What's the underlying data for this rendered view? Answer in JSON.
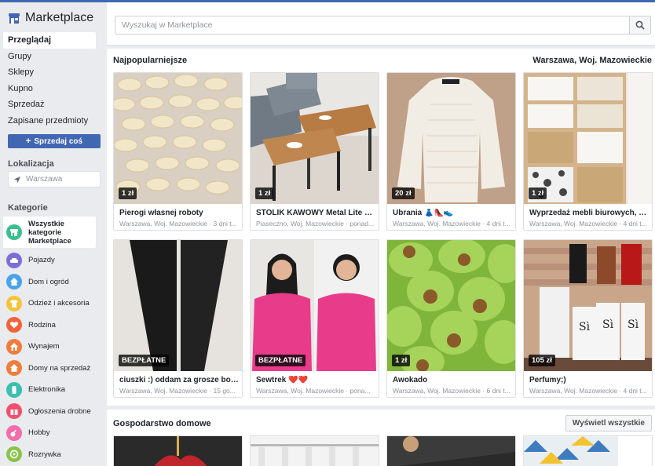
{
  "app": {
    "title": "Marketplace"
  },
  "nav": [
    {
      "label": "Przeglądaj",
      "active": true
    },
    {
      "label": "Grupy",
      "active": false
    },
    {
      "label": "Sklepy",
      "active": false
    },
    {
      "label": "Kupno",
      "active": false
    },
    {
      "label": "Sprzedaż",
      "active": false
    },
    {
      "label": "Zapisane przedmioty",
      "active": false
    }
  ],
  "sell_button": {
    "label": "Sprzedaj coś",
    "icon": "plus-icon"
  },
  "location": {
    "section_label": "Lokalizacja",
    "value": "Warszawa",
    "icon": "location-arrow-icon"
  },
  "categories": {
    "section_label": "Kategorie",
    "all": {
      "label": "Wszystkie kategorie Marketplace",
      "icon": "store-icon",
      "color": "#3bbf8f"
    },
    "items": [
      {
        "label": "Pojazdy",
        "icon": "car-icon",
        "color": "#7b6fd6"
      },
      {
        "label": "Dom i ogród",
        "icon": "home-icon",
        "color": "#4aa3e8"
      },
      {
        "label": "Odzież i akcesoria",
        "icon": "clothing-icon",
        "color": "#f5c33b"
      },
      {
        "label": "Rodzina",
        "icon": "heart-icon",
        "color": "#f0633b"
      },
      {
        "label": "Wynajem",
        "icon": "key-icon",
        "color": "#f07d3b"
      },
      {
        "label": "Domy na sprzedaż",
        "icon": "house-sale-icon",
        "color": "#f07d3b"
      },
      {
        "label": "Elektronika",
        "icon": "phone-icon",
        "color": "#3bbfae"
      },
      {
        "label": "Ogłoszenia drobne",
        "icon": "gift-icon",
        "color": "#f0506e"
      },
      {
        "label": "Hobby",
        "icon": "guitar-icon",
        "color": "#f06ea9"
      },
      {
        "label": "Rozrywka",
        "icon": "gamepad-icon",
        "color": "#8bc34a"
      }
    ]
  },
  "search": {
    "placeholder": "Wyszukaj w Marketplace",
    "icon": "search-icon"
  },
  "popular": {
    "title": "Najpopularniejsze",
    "location": "Warszawa, Woj. Mazowieckie",
    "listings": [
      {
        "title": "Pierogi własnej roboty",
        "price": "1 zł",
        "meta": "Warszawa, Woj. Mazowieckie · 3 dni t...",
        "image": "pierogi"
      },
      {
        "title": "STOLIK KAWOWY Metal Lite Dr...",
        "price": "1 zł",
        "meta": "Piaseczno, Woj. Mazowieckie · ponad...",
        "image": "coffee-table"
      },
      {
        "title": "Ubrania 👗👠👟",
        "price": "20 zł",
        "meta": "Warszawa, Woj. Mazowieckie · 4 dni t...",
        "image": "sweater"
      },
      {
        "title": "Wyprzedaż mebli biurowych, wi...",
        "price": "1 zł",
        "meta": "Warszawa, Woj. Mazowieckie · 4 dni t...",
        "image": "shelf"
      },
      {
        "title": "ciuszki :) oddam za grosze bo ni...",
        "price": "BEZPŁATNE",
        "meta": "Warszawa, Woj. Mazowieckie · 15 go...",
        "image": "leggings"
      },
      {
        "title": "Sewtrek ❤️❤️",
        "price": "BEZPŁATNE",
        "meta": "Warszawa, Woj. Mazowieckie · pona...",
        "image": "pink-sweater"
      },
      {
        "title": "Awokado",
        "price": "1 zł",
        "meta": "Warszawa, Woj. Mazowieckie · 6 dni t...",
        "image": "avocado-toys"
      },
      {
        "title": "Perfumy;)",
        "price": "105 zł",
        "meta": "Warszawa, Woj. Mazowieckie · 4 dni t...",
        "image": "perfumes"
      }
    ]
  },
  "household": {
    "title": "Gospodarstwo domowe",
    "show_all_label": "Wyświetl wszystkie"
  }
}
